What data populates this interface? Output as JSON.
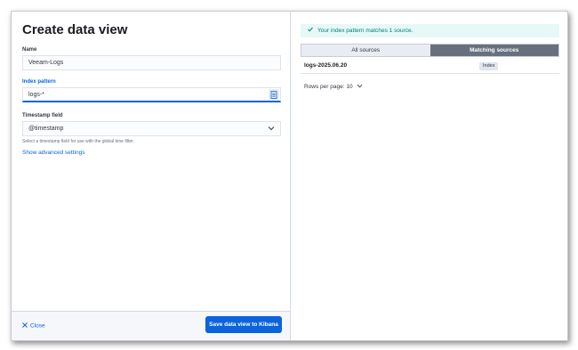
{
  "form": {
    "title": "Create data view",
    "name_label": "Name",
    "name_value": "Veeam-Logs",
    "index_label": "Index pattern",
    "index_value": "logs-*",
    "timestamp_label": "Timestamp field",
    "timestamp_value": "@timestamp",
    "timestamp_help": "Select a timestamp field for use with the global time filter.",
    "advanced_link": "Show advanced settings"
  },
  "footer": {
    "close_label": "Close",
    "save_label": "Save data view to Kibana"
  },
  "results": {
    "success_message": "Your index pattern matches 1 source.",
    "tabs": [
      {
        "label": "All sources",
        "selected": false
      },
      {
        "label": "Matching sources",
        "selected": true
      }
    ],
    "rows": [
      {
        "name": "logs-2025.06.20",
        "type": "Index"
      }
    ],
    "rows_per_page": "Rows per page: 10"
  },
  "colors": {
    "accent": "#0b64dd",
    "success": "#017d73",
    "selected_tab": "#69707d"
  },
  "icons": {
    "index_field": "list-icon",
    "dropdown": "chevron-down-icon",
    "close": "close-icon",
    "success": "check-icon"
  }
}
